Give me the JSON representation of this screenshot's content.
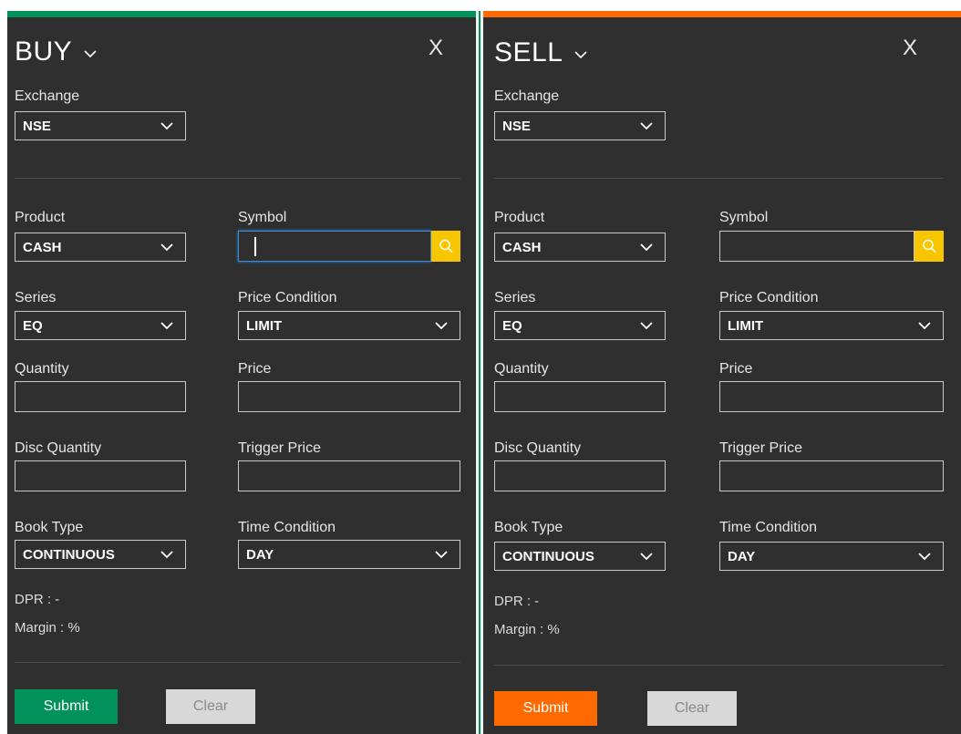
{
  "buy": {
    "title": "BUY",
    "close_label": "X",
    "exchange": {
      "label": "Exchange",
      "value": "NSE"
    },
    "product": {
      "label": "Product",
      "value": "CASH"
    },
    "symbol": {
      "label": "Symbol",
      "value": ""
    },
    "series": {
      "label": "Series",
      "value": "EQ"
    },
    "price_condition": {
      "label": "Price Condition",
      "value": "LIMIT"
    },
    "quantity": {
      "label": "Quantity",
      "value": ""
    },
    "price": {
      "label": "Price",
      "value": ""
    },
    "disc_quantity": {
      "label": "Disc Quantity",
      "value": ""
    },
    "trigger_price": {
      "label": "Trigger Price",
      "value": ""
    },
    "book_type": {
      "label": "Book Type",
      "value": "CONTINUOUS"
    },
    "time_condition": {
      "label": "Time Condition",
      "value": "DAY"
    },
    "dpr": "DPR : -",
    "margin": "Margin : %",
    "submit_label": "Submit",
    "clear_label": "Clear"
  },
  "sell": {
    "title": "SELL",
    "close_label": "X",
    "exchange": {
      "label": "Exchange",
      "value": "NSE"
    },
    "product": {
      "label": "Product",
      "value": "CASH"
    },
    "symbol": {
      "label": "Symbol",
      "value": ""
    },
    "series": {
      "label": "Series",
      "value": "EQ"
    },
    "price_condition": {
      "label": "Price Condition",
      "value": "LIMIT"
    },
    "quantity": {
      "label": "Quantity",
      "value": ""
    },
    "price": {
      "label": "Price",
      "value": ""
    },
    "disc_quantity": {
      "label": "Disc Quantity",
      "value": ""
    },
    "trigger_price": {
      "label": "Trigger Price",
      "value": ""
    },
    "book_type": {
      "label": "Book Type",
      "value": "CONTINUOUS"
    },
    "time_condition": {
      "label": "Time Condition",
      "value": "DAY"
    },
    "dpr": "DPR : -",
    "margin": "Margin : %",
    "submit_label": "Submit",
    "clear_label": "Clear"
  },
  "colors": {
    "panel_bg": "#2f2f2f",
    "buy_accent": "#00925a",
    "sell_accent": "#ff6a00",
    "search_button": "#f7c600",
    "clear_button": "#d8d8d8"
  },
  "icons": [
    "chevron-down-icon",
    "search-icon"
  ]
}
